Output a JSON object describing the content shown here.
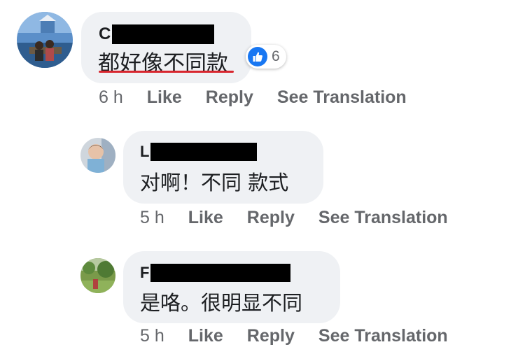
{
  "comments": [
    {
      "initial": "C",
      "text": "都好像不同款",
      "reaction": {
        "type": "like",
        "count": "6"
      },
      "time": "6 h",
      "like_label": "Like",
      "reply_label": "Reply",
      "translate_label": "See Translation"
    },
    {
      "initial": "L",
      "text": "对啊！不同 款式",
      "time": "5 h",
      "like_label": "Like",
      "reply_label": "Reply",
      "translate_label": "See Translation"
    },
    {
      "initial": "F",
      "text": "是咯。很明显不同",
      "time": "5 h",
      "like_label": "Like",
      "reply_label": "Reply",
      "translate_label": "See Translation"
    }
  ],
  "colors": {
    "bubble": "#eff1f4",
    "text": "#1c1e21",
    "meta": "#65676b",
    "like_blue": "#1877f2",
    "underline": "#d8262e"
  }
}
